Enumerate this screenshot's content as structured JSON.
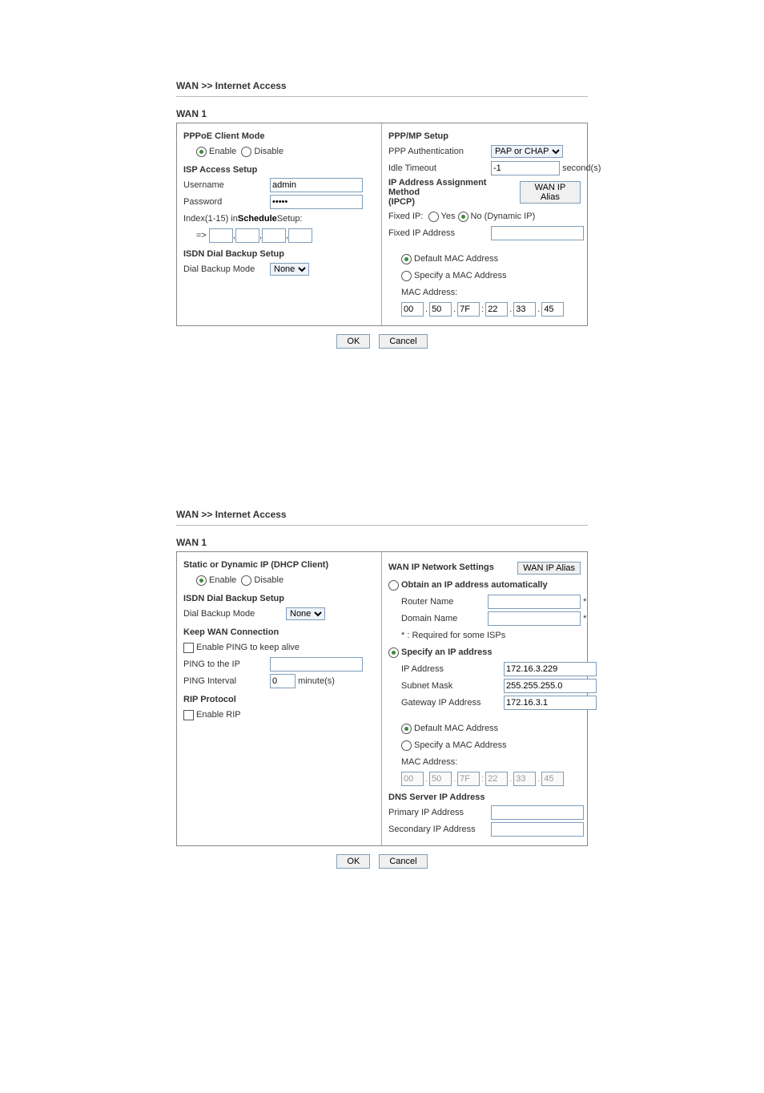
{
  "section1": {
    "breadcrumb": "WAN >> Internet Access",
    "wan_title": "WAN 1",
    "left": {
      "pppoe_heading": "PPPoE Client Mode",
      "enable_label": "Enable",
      "disable_label": "Disable",
      "isp_heading": "ISP Access Setup",
      "username_label": "Username",
      "username_value": "admin",
      "password_label": "Password",
      "password_value": "•••••",
      "index_label_prefix": "Index(1-15) in ",
      "schedule_link": "Schedule",
      "index_label_suffix": " Setup:",
      "arrow": "=>",
      "isdn_heading": "ISDN Dial Backup Setup",
      "dial_backup_label": "Dial Backup Mode",
      "dial_backup_value": "None"
    },
    "right": {
      "ppp_heading": "PPP/MP Setup",
      "ppp_auth_label": "PPP Authentication",
      "ppp_auth_value": "PAP or CHAP",
      "idle_label": "Idle Timeout",
      "idle_value": "-1",
      "idle_unit": "second(s)",
      "ipcp_heading": "IP Address Assignment Method (IPCP)",
      "wan_alias_btn": "WAN IP Alias",
      "fixed_ip_label": "Fixed IP:",
      "yes_label": "Yes",
      "no_label": "No (Dynamic IP)",
      "fixed_ip_addr_label": "Fixed IP Address",
      "default_mac_label": "Default MAC Address",
      "specify_mac_label": "Specify a MAC Address",
      "mac_addr_label": "MAC Address:",
      "mac": [
        "00",
        "50",
        "7F",
        "22",
        "33",
        "45"
      ]
    },
    "ok": "OK",
    "cancel": "Cancel"
  },
  "section2": {
    "breadcrumb": "WAN >> Internet Access",
    "wan_title": "WAN 1",
    "left": {
      "static_heading": "Static or Dynamic IP (DHCP Client)",
      "enable_label": "Enable",
      "disable_label": "Disable",
      "isdn_heading": "ISDN Dial Backup Setup",
      "dial_backup_label": "Dial Backup Mode",
      "dial_backup_value": "None",
      "keep_heading": "Keep WAN Connection",
      "enable_ping_label": "Enable PING to keep alive",
      "ping_ip_label": "PING to the IP",
      "ping_interval_label": "PING Interval",
      "ping_interval_value": "0",
      "ping_interval_unit": "minute(s)",
      "rip_heading": "RIP Protocol",
      "enable_rip_label": "Enable RIP"
    },
    "right": {
      "wan_ip_heading": "WAN IP Network Settings",
      "wan_alias_btn": "WAN IP Alias",
      "obtain_label": "Obtain an IP address automatically",
      "router_name_label": "Router Name",
      "domain_name_label": "Domain Name",
      "required_note": "* : Required for some ISPs",
      "specify_ip_label": "Specify an IP address",
      "ip_addr_label": "IP Address",
      "ip_addr_value": "172.16.3.229",
      "subnet_label": "Subnet Mask",
      "subnet_value": "255.255.255.0",
      "gateway_label": "Gateway IP Address",
      "gateway_value": "172.16.3.1",
      "default_mac_label": "Default MAC Address",
      "specify_mac_label": "Specify a MAC Address",
      "mac_addr_label": "MAC Address:",
      "mac": [
        "00",
        "50",
        "7F",
        "22",
        "33",
        "45"
      ],
      "dns_heading": "DNS Server IP Address",
      "primary_label": "Primary IP Address",
      "secondary_label": "Secondary IP Address",
      "asterisk": "*"
    },
    "ok": "OK",
    "cancel": "Cancel"
  }
}
